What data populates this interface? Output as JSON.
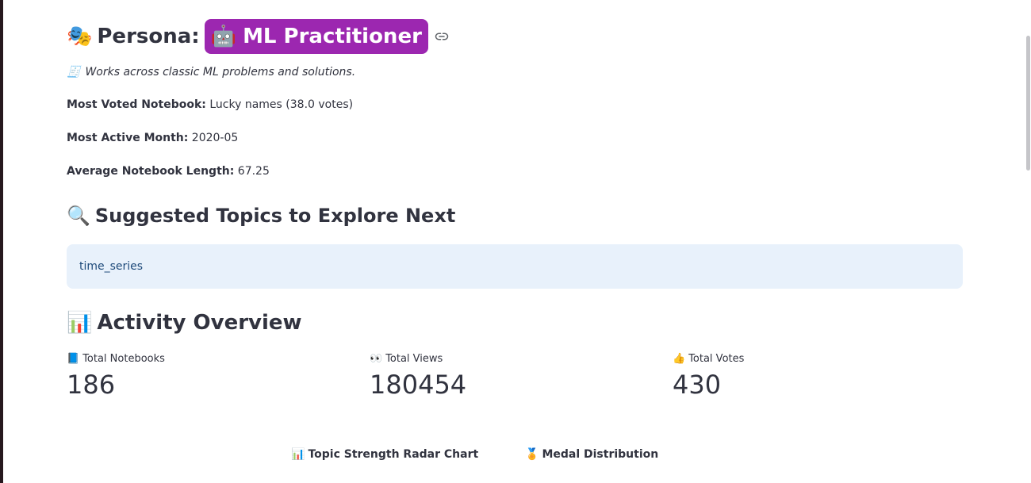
{
  "persona": {
    "emoji": "🎭",
    "label": "Persona:",
    "badge_emoji": "🤖",
    "badge_text": "ML Practitioner",
    "badge_color": "#9c27b0"
  },
  "description": {
    "icon": "🧾",
    "text": "Works across classic ML problems and solutions."
  },
  "stats": {
    "most_voted": {
      "label": "Most Voted Notebook:",
      "value": "Lucky names (38.0 votes)"
    },
    "most_active": {
      "label": "Most Active Month:",
      "value": "2020-05"
    },
    "avg_length": {
      "label": "Average Notebook Length:",
      "value": "67.25"
    }
  },
  "topics": {
    "emoji": "🔍",
    "title": "Suggested Topics to Explore Next",
    "item": "time_series"
  },
  "activity": {
    "emoji": "📊",
    "title": "Activity Overview",
    "metrics": [
      {
        "icon": "📘",
        "label": "Total Notebooks",
        "value": "186"
      },
      {
        "icon": "👀",
        "label": "Total Views",
        "value": "180454"
      },
      {
        "icon": "👍",
        "label": "Total Votes",
        "value": "430"
      }
    ]
  },
  "sections": {
    "radar": {
      "icon": "📊",
      "title": "Topic Strength Radar Chart"
    },
    "medals": {
      "icon": "🏅",
      "title": "Medal Distribution"
    }
  },
  "icons": {
    "link": "link-icon"
  }
}
